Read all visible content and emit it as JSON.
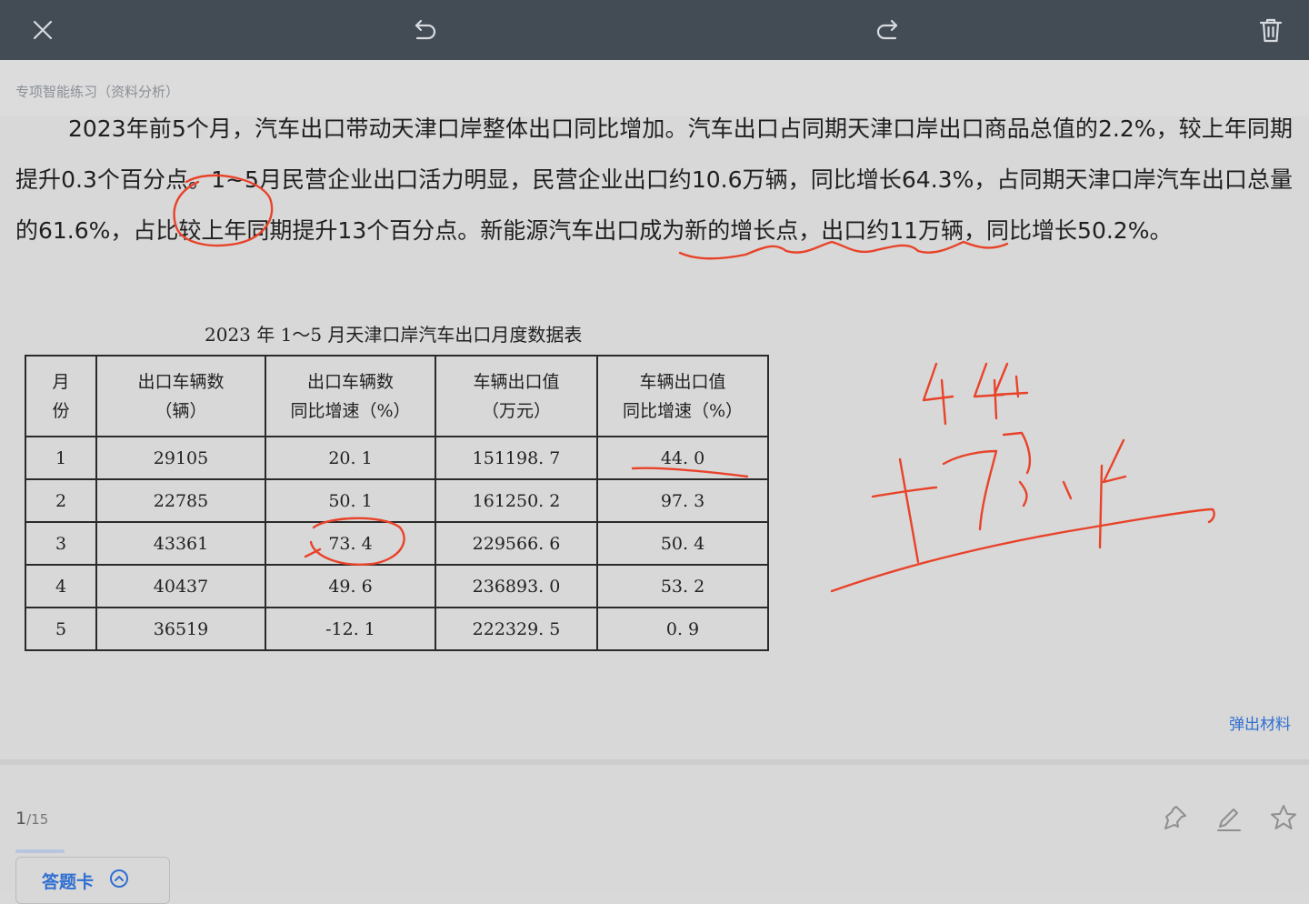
{
  "toolbar": {
    "icons": [
      "close-icon",
      "undo-icon",
      "redo-icon",
      "trash-icon"
    ]
  },
  "header": {
    "breadcrumb": "专项智能练习（资料分析）"
  },
  "passage": {
    "line1": "2023年前5个月，汽车出口带动天津口岸整体出口同比增加。汽车出口占同期天津口岸出口商品总值的2.2%，较上年同期提升0.3个百分点。1~5月民营企业出口活力明显，民营企业出口约10.6万辆，同比增长64.3%，占同期天津口岸汽车出口总量的61.6%，占比较上年同期提升13个百分点。新能源汽车出口成为新的增长点，出口约11万辆，同比增长50.2%。"
  },
  "table": {
    "title": "2023 年 1～5 月天津口岸汽车出口月度数据表",
    "headers": [
      {
        "l1": "月",
        "l2": "份"
      },
      {
        "l1": "出口车辆数",
        "l2": "（辆）"
      },
      {
        "l1": "出口车辆数",
        "l2": "同比增速（%）"
      },
      {
        "l1": "车辆出口值",
        "l2": "（万元）"
      },
      {
        "l1": "车辆出口值",
        "l2": "同比增速（%）"
      }
    ],
    "rows": [
      [
        "1",
        "29105",
        "20. 1",
        "151198. 7",
        "44. 0"
      ],
      [
        "2",
        "22785",
        "50. 1",
        "161250. 2",
        "97. 3"
      ],
      [
        "3",
        "43361",
        "73. 4",
        "229566. 6",
        "50. 4"
      ],
      [
        "4",
        "40437",
        "49. 6",
        "236893. 0",
        "53. 2"
      ],
      [
        "5",
        "36519",
        "-12. 1",
        "222329. 5",
        "0. 9"
      ]
    ]
  },
  "popout_label": "弹出材料",
  "footer": {
    "page_current": "1",
    "page_total": "/15",
    "answer_card_label": "答题卡",
    "icons": [
      "pin-icon",
      "edit-icon",
      "star-icon"
    ]
  },
  "annotation": {
    "color": "#e8432a",
    "note": "44 173.4"
  }
}
